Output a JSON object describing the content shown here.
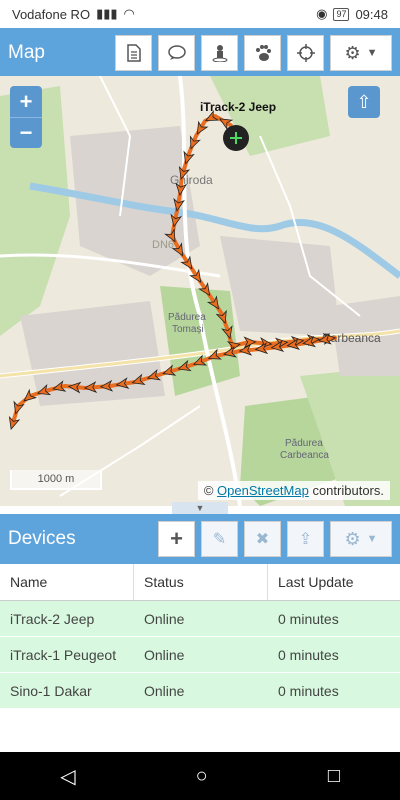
{
  "status_bar": {
    "carrier": "Vodafone RO",
    "battery": "97",
    "time": "09:48"
  },
  "map_panel": {
    "title": "Map",
    "toolbar": [
      "report-icon",
      "chat-icon",
      "person-pin-icon",
      "paw-icon",
      "crosshair-icon",
      "gear-icon"
    ],
    "zoom_in": "+",
    "zoom_out": "−",
    "device_label": "iTrack-2 Jeep",
    "scale": "1000 m",
    "attribution_prefix": "©",
    "attribution_link": "OpenStreetMap",
    "attribution_suffix": "contributors.",
    "places": [
      "Ghiroda",
      "Carbeanca",
      "Pădurea Tomași",
      "Pădurea Carbeanca",
      "DN6"
    ]
  },
  "devices_panel": {
    "title": "Devices",
    "columns": [
      "Name",
      "Status",
      "Last Update"
    ],
    "rows": [
      {
        "name": "iTrack-2 Jeep",
        "status": "Online",
        "last_update": "0 minutes"
      },
      {
        "name": "iTrack-1 Peugeot",
        "status": "Online",
        "last_update": "0 minutes"
      },
      {
        "name": "Sino-1 Dakar",
        "status": "Online",
        "last_update": "0 minutes"
      }
    ]
  },
  "colors": {
    "header": "#5da3dc",
    "track": "#f07a2e",
    "online_row": "#d8f9df"
  }
}
